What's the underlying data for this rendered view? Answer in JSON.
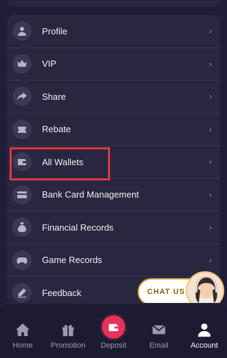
{
  "menu": {
    "items": [
      {
        "label": "Profile",
        "icon": "user-icon"
      },
      {
        "label": "VIP",
        "icon": "crown-icon"
      },
      {
        "label": "Share",
        "icon": "share-icon"
      },
      {
        "label": "Rebate",
        "icon": "ticket-icon"
      },
      {
        "label": "All Wallets",
        "icon": "wallet-icon"
      },
      {
        "label": "Bank Card Management",
        "icon": "card-icon"
      },
      {
        "label": "Financial Records",
        "icon": "money-bag-icon"
      },
      {
        "label": "Game Records",
        "icon": "gamepad-icon"
      },
      {
        "label": "Feedback",
        "icon": "pencil-icon"
      }
    ],
    "chevron": "›"
  },
  "chat": {
    "label": "CHAT US"
  },
  "nav": {
    "items": [
      {
        "label": "Home",
        "icon": "home-icon"
      },
      {
        "label": "Promotion",
        "icon": "gift-icon"
      },
      {
        "label": "Deposit",
        "icon": "wallet-icon"
      },
      {
        "label": "Email",
        "icon": "mail-icon"
      },
      {
        "label": "Account",
        "icon": "user-icon"
      }
    ],
    "active": "Account"
  },
  "colors": {
    "background": "#1f1d37",
    "card": "#29273f",
    "accent": "#e8305a",
    "highlight": "#e03a3a"
  }
}
